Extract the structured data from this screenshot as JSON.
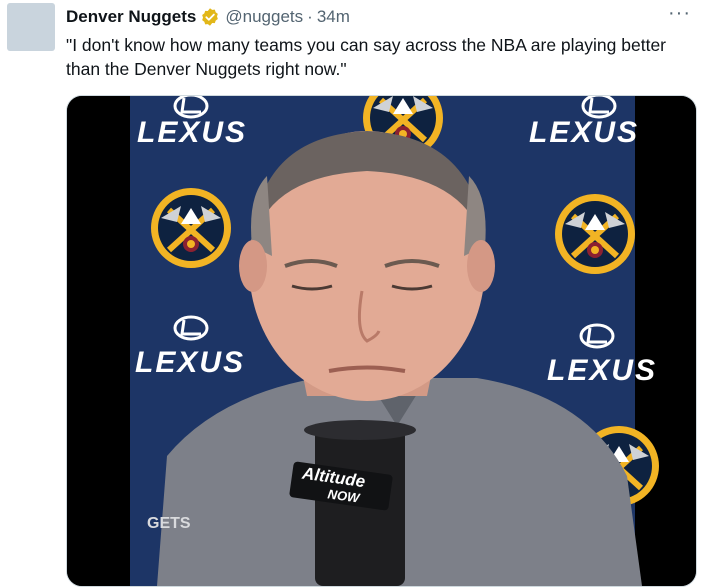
{
  "tweet": {
    "author_name": "Denver Nuggets",
    "handle": "@nuggets",
    "separator": "·",
    "time": "34m",
    "more_label": "···",
    "text": "\"I don't know how many teams you can say across the NBA are playing better than the Denver Nuggets right now.\"",
    "verified_icon": "verified-badge-icon"
  },
  "media": {
    "type": "video",
    "backdrop_brand": "LEXUS",
    "mic_brand_line1": "Altitude",
    "mic_brand_line2": "NOW",
    "shirt_text": "GETS",
    "colors": {
      "backdrop": "#1d3566",
      "nuggets_gold": "#f2b424",
      "nuggets_navy": "#0e2240",
      "nuggets_red": "#8b2131",
      "shirt": "#7d8089"
    }
  }
}
